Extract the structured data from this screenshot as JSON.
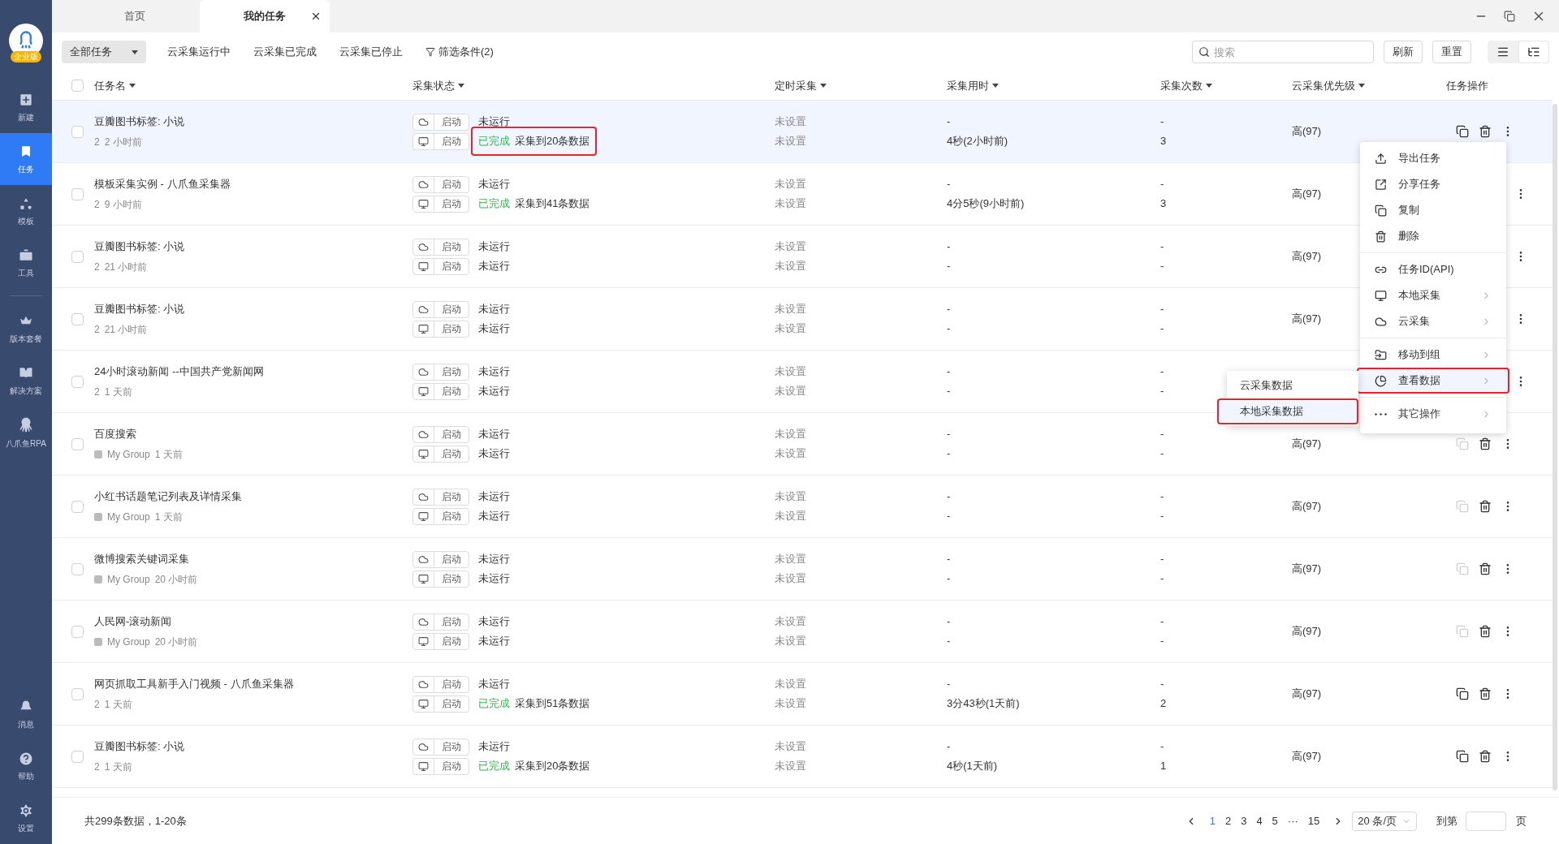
{
  "sidebar": {
    "logo_badge": "企业版",
    "items": [
      {
        "label": "新建",
        "selected": false
      },
      {
        "label": "任务",
        "selected": true
      },
      {
        "label": "模板",
        "selected": false
      },
      {
        "label": "工具",
        "selected": false
      },
      {
        "label": "版本套餐",
        "selected": false
      },
      {
        "label": "解决方案",
        "selected": false
      },
      {
        "label": "八爪鱼RPA",
        "selected": false
      }
    ],
    "bottom_items": [
      {
        "label": "消息"
      },
      {
        "label": "帮助"
      },
      {
        "label": "设置"
      }
    ]
  },
  "tabs": [
    {
      "label": "首页",
      "selected": false,
      "closable": false
    },
    {
      "label": "我的任务",
      "selected": true,
      "closable": true
    }
  ],
  "toolbar": {
    "dropdown": "全部任务",
    "filters": [
      "云采集运行中",
      "云采集已完成",
      "云采集已停止"
    ],
    "condition_filter": "筛选条件(2)",
    "search": {
      "placeholder": "搜索"
    },
    "buttons": [
      "刷新",
      "重置"
    ],
    "view_modes": [
      {
        "selected": false
      },
      {
        "selected": true
      }
    ]
  },
  "table": {
    "all_checked": false,
    "columns": [
      {
        "label": "任务名",
        "sortable": true
      },
      {
        "label": "采集状态",
        "sortable": true
      },
      {
        "label": "定时采集",
        "sortable": true
      },
      {
        "label": "采集用时",
        "sortable": true
      },
      {
        "label": "采集次数",
        "sortable": true
      },
      {
        "label": "云采集优先级",
        "sortable": true
      },
      {
        "label": "任务操作",
        "sortable": false
      }
    ],
    "rows": [
      {
        "selected": true,
        "checked": false,
        "name": "豆瓣图书标签: 小说",
        "group": "2",
        "group_icon": false,
        "time": "2 小时前",
        "status": [
          {
            "kind": "cloud",
            "button": "启动",
            "state": "未运行",
            "finished": false,
            "marked": false
          },
          {
            "kind": "local",
            "button": "启动",
            "state": "已完成",
            "finished": true,
            "detail": "采集到20条数据",
            "marked": true
          }
        ],
        "schedule": [
          "未设置",
          "未设置"
        ],
        "duration": [
          "-",
          "4秒(2小时前)"
        ],
        "runs": [
          "-",
          "3"
        ],
        "priority": "高(97)",
        "copy_disabled": false
      },
      {
        "selected": false,
        "checked": false,
        "name": "模板采集实例 - 八爪鱼采集器",
        "group": "2",
        "group_icon": false,
        "time": "9 小时前",
        "status": [
          {
            "kind": "cloud",
            "button": "启动",
            "state": "未运行",
            "finished": false,
            "marked": false
          },
          {
            "kind": "local",
            "button": "启动",
            "state": "已完成",
            "finished": true,
            "detail": "采集到41条数据",
            "marked": false
          }
        ],
        "schedule": [
          "未设置",
          "未设置"
        ],
        "duration": [
          "-",
          "4分5秒(9小时前)"
        ],
        "runs": [
          "-",
          "3"
        ],
        "priority": "高(97)"
      },
      {
        "selected": false,
        "checked": false,
        "name": "豆瓣图书标签: 小说",
        "group": "2",
        "group_icon": false,
        "time": "21 小时前",
        "status": [
          {
            "kind": "cloud",
            "button": "启动",
            "state": "未运行",
            "finished": false,
            "marked": false
          },
          {
            "kind": "local",
            "button": "启动",
            "state": "未运行",
            "finished": false,
            "marked": false
          }
        ],
        "schedule": [
          "未设置",
          "未设置"
        ],
        "duration": [
          "-",
          "-"
        ],
        "runs": [
          "-",
          "-"
        ],
        "priority": "高(97)"
      },
      {
        "selected": false,
        "checked": false,
        "name": "豆瓣图书标签: 小说",
        "group": "2",
        "group_icon": false,
        "time": "21 小时前",
        "status": [
          {
            "kind": "cloud",
            "button": "启动",
            "state": "未运行",
            "finished": false,
            "marked": false
          },
          {
            "kind": "local",
            "button": "启动",
            "state": "未运行",
            "finished": false,
            "marked": false
          }
        ],
        "schedule": [
          "未设置",
          "未设置"
        ],
        "duration": [
          "-",
          "-"
        ],
        "runs": [
          "-",
          "-"
        ],
        "priority": "高(97)"
      },
      {
        "selected": false,
        "checked": false,
        "name": "24小时滚动新闻 --中国共产党新闻网",
        "group": "2",
        "group_icon": false,
        "time": "1 天前",
        "status": [
          {
            "kind": "cloud",
            "button": "启动",
            "state": "未运行",
            "finished": false,
            "marked": false
          },
          {
            "kind": "local",
            "button": "启动",
            "state": "未运行",
            "finished": false,
            "marked": false
          }
        ],
        "schedule": [
          "未设置",
          "未设置"
        ],
        "duration": [
          "-",
          "-"
        ],
        "runs": [
          "-",
          "-"
        ]
      },
      {
        "selected": false,
        "checked": false,
        "name": "百度搜索",
        "group": "My Group",
        "group_icon": true,
        "time": "1 天前",
        "status": [
          {
            "kind": "cloud",
            "button": "启动",
            "state": "未运行",
            "finished": false,
            "marked": false
          },
          {
            "kind": "local",
            "button": "启动",
            "state": "未运行",
            "finished": false,
            "marked": false
          }
        ],
        "schedule": [
          "未设置",
          "未设置"
        ],
        "duration": [
          "-",
          "-"
        ],
        "runs": [
          "-",
          "-"
        ],
        "priority": "高(97)",
        "copy_disabled": true
      },
      {
        "selected": false,
        "checked": false,
        "name": "小红书话题笔记列表及详情采集",
        "group": "My Group",
        "group_icon": true,
        "time": "1 天前",
        "status": [
          {
            "kind": "cloud",
            "button": "启动",
            "state": "未运行",
            "finished": false,
            "marked": false
          },
          {
            "kind": "local",
            "button": "启动",
            "state": "未运行",
            "finished": false,
            "marked": false
          }
        ],
        "schedule": [
          "未设置",
          "未设置"
        ],
        "duration": [
          "-",
          "-"
        ],
        "runs": [
          "-",
          "-"
        ],
        "priority": "高(97)",
        "copy_disabled": true
      },
      {
        "selected": false,
        "checked": false,
        "name": "微博搜索关键词采集",
        "group": "My Group",
        "group_icon": true,
        "time": "20 小时前",
        "status": [
          {
            "kind": "cloud",
            "button": "启动",
            "state": "未运行",
            "finished": false,
            "marked": false
          },
          {
            "kind": "local",
            "button": "启动",
            "state": "未运行",
            "finished": false,
            "marked": false
          }
        ],
        "schedule": [
          "未设置",
          "未设置"
        ],
        "duration": [
          "-",
          "-"
        ],
        "runs": [
          "-",
          "-"
        ],
        "priority": "高(97)",
        "copy_disabled": true
      },
      {
        "selected": false,
        "checked": false,
        "name": "人民网-滚动新闻",
        "group": "My Group",
        "group_icon": true,
        "time": "20 小时前",
        "status": [
          {
            "kind": "cloud",
            "button": "启动",
            "state": "未运行",
            "finished": false,
            "marked": false
          },
          {
            "kind": "local",
            "button": "启动",
            "state": "未运行",
            "finished": false,
            "marked": false
          }
        ],
        "schedule": [
          "未设置",
          "未设置"
        ],
        "duration": [
          "-",
          "-"
        ],
        "runs": [
          "-",
          "-"
        ],
        "priority": "高(97)",
        "copy_disabled": true
      },
      {
        "selected": false,
        "checked": false,
        "name": "网页抓取工具新手入门视频 - 八爪鱼采集器",
        "group": "2",
        "group_icon": false,
        "time": "1 天前",
        "status": [
          {
            "kind": "cloud",
            "button": "启动",
            "state": "未运行",
            "finished": false,
            "marked": false
          },
          {
            "kind": "local",
            "button": "启动",
            "state": "已完成",
            "finished": true,
            "detail": "采集到51条数据",
            "marked": false
          }
        ],
        "schedule": [
          "未设置",
          "未设置"
        ],
        "duration": [
          "-",
          "3分43秒(1天前)"
        ],
        "runs": [
          "-",
          "2"
        ],
        "priority": "高(97)",
        "copy_disabled": false
      },
      {
        "selected": false,
        "checked": false,
        "name": "豆瓣图书标签: 小说",
        "group": "2",
        "group_icon": false,
        "time": "1 天前",
        "status": [
          {
            "kind": "cloud",
            "button": "启动",
            "state": "未运行",
            "finished": false,
            "marked": false
          },
          {
            "kind": "local",
            "button": "启动",
            "state": "已完成",
            "finished": true,
            "detail": "采集到20条数据",
            "marked": false
          }
        ],
        "schedule": [
          "未设置",
          "未设置"
        ],
        "duration": [
          "-",
          "4秒(1天前)"
        ],
        "runs": [
          "-",
          "1"
        ],
        "priority": "高(97)",
        "copy_disabled": false
      }
    ]
  },
  "context_menu": {
    "groups": [
      [
        {
          "label": "导出任务",
          "has_submenu": false,
          "highlighted": false
        },
        {
          "label": "分享任务",
          "has_submenu": false,
          "highlighted": false
        },
        {
          "label": "复制",
          "has_submenu": false,
          "highlighted": false
        },
        {
          "label": "删除",
          "has_submenu": false,
          "highlighted": false
        }
      ],
      [
        {
          "label": "任务ID(API)",
          "has_submenu": false,
          "highlighted": false
        },
        {
          "label": "本地采集",
          "has_submenu": true,
          "highlighted": false
        },
        {
          "label": "云采集",
          "has_submenu": true,
          "highlighted": false
        }
      ],
      [
        {
          "label": "移动到组",
          "has_submenu": true,
          "highlighted": false
        },
        {
          "label": "查看数据",
          "has_submenu": true,
          "highlighted": true
        }
      ],
      [
        {
          "label": "其它操作",
          "has_submenu": true,
          "highlighted": false
        }
      ]
    ],
    "submenu": [
      {
        "label": "云采集数据",
        "highlighted": false
      },
      {
        "label": "本地采集数据",
        "highlighted": true
      }
    ]
  },
  "footer": {
    "summary": "共299条数据，1-20条",
    "pages": [
      {
        "label": "1",
        "selected": true
      },
      {
        "label": "2",
        "selected": false
      },
      {
        "label": "3",
        "selected": false
      },
      {
        "label": "4",
        "selected": false
      },
      {
        "label": "5",
        "selected": false
      },
      {
        "label": "···",
        "selected": false
      },
      {
        "label": "15",
        "selected": false
      }
    ],
    "page_size": "20 条/页",
    "goto_label": "到第",
    "goto_suffix": "页"
  }
}
